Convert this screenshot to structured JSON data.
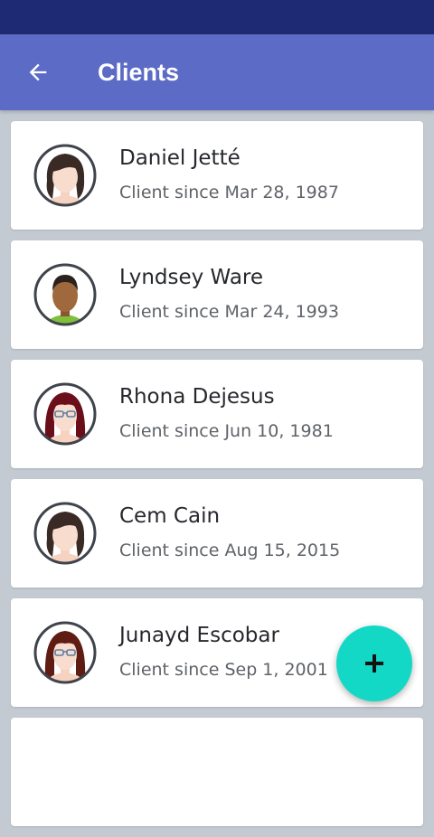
{
  "colors": {
    "status_bar": "#1f2a74",
    "app_bar": "#5c6bc6",
    "background": "#c4cad2",
    "fab": "#13d8c6"
  },
  "app_bar": {
    "title": "Clients",
    "back_icon": "arrow-left-icon"
  },
  "clients": [
    {
      "name": "Daniel Jetté",
      "since": "Client since Mar 28, 1987",
      "avatar": "woman-avatar"
    },
    {
      "name": "Lyndsey Ware",
      "since": "Client since Mar 24, 1993",
      "avatar": "man-avatar"
    },
    {
      "name": "Rhona Dejesus",
      "since": "Client since Jun 10, 1981",
      "avatar": "woman-glasses-avatar"
    },
    {
      "name": "Cem Cain",
      "since": "Client since Aug 15, 2015",
      "avatar": "woman-avatar"
    },
    {
      "name": "Junayd Escobar",
      "since": "Client since Sep 1, 2001",
      "avatar": "woman-glasses-avatar"
    }
  ],
  "fab": {
    "icon": "plus-icon"
  }
}
